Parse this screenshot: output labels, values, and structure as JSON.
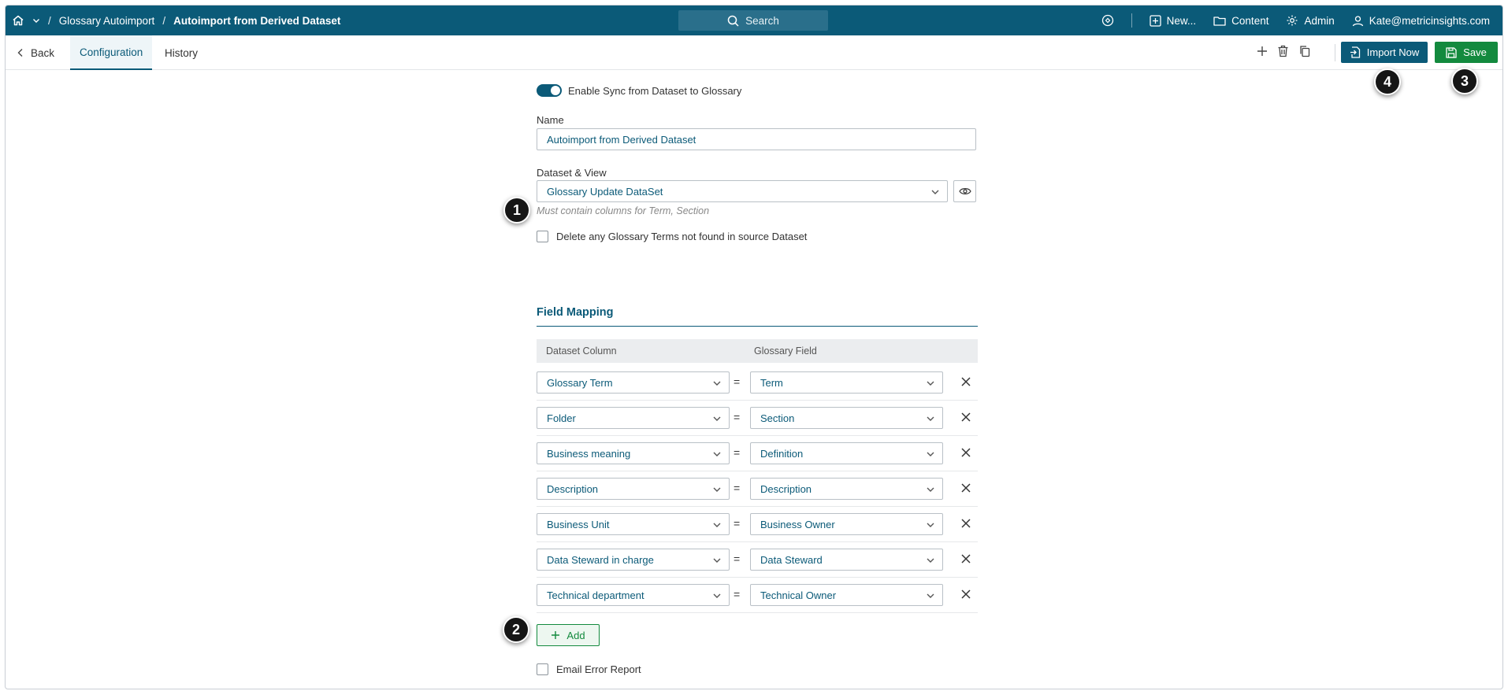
{
  "topbar": {
    "breadcrumb_parent": "Glossary Autoimport",
    "breadcrumb_current": "Autoimport from Derived Dataset",
    "separator": "/",
    "search_label": "Search",
    "new_label": "New...",
    "content_label": "Content",
    "admin_label": "Admin",
    "user_label": "Kate@metricinsights.com"
  },
  "subbar": {
    "back_label": "Back",
    "tabs": [
      {
        "label": "Configuration",
        "active": true
      },
      {
        "label": "History",
        "active": false
      }
    ],
    "import_label": "Import Now",
    "save_label": "Save"
  },
  "form": {
    "enable_sync_label": "Enable Sync from Dataset to Glossary",
    "enable_sync_on": true,
    "name_label": "Name",
    "name_value": "Autoimport from Derived Dataset",
    "dataset_label": "Dataset & View",
    "dataset_value": "Glossary Update DataSet",
    "dataset_hint": "Must contain columns for Term, Section",
    "delete_terms_label": "Delete any Glossary Terms not found in source Dataset",
    "field_mapping_title": "Field Mapping",
    "col_dataset": "Dataset Column",
    "col_glossary": "Glossary Field",
    "equals": "=",
    "mappings": [
      {
        "dataset": "Glossary Term",
        "glossary": "Term"
      },
      {
        "dataset": "Folder",
        "glossary": "Section"
      },
      {
        "dataset": "Business meaning",
        "glossary": "Definition"
      },
      {
        "dataset": "Description",
        "glossary": "Description"
      },
      {
        "dataset": "Business Unit",
        "glossary": "Business Owner"
      },
      {
        "dataset": "Data Steward in charge",
        "glossary": "Data Steward"
      },
      {
        "dataset": "Technical department",
        "glossary": "Technical Owner"
      }
    ],
    "add_label": "Add",
    "email_error_label": "Email Error Report"
  },
  "callouts": [
    "1",
    "2",
    "3",
    "4"
  ],
  "colors": {
    "primary": "#0b5a78",
    "save_green": "#138a3e",
    "callout_black": "#161616"
  }
}
